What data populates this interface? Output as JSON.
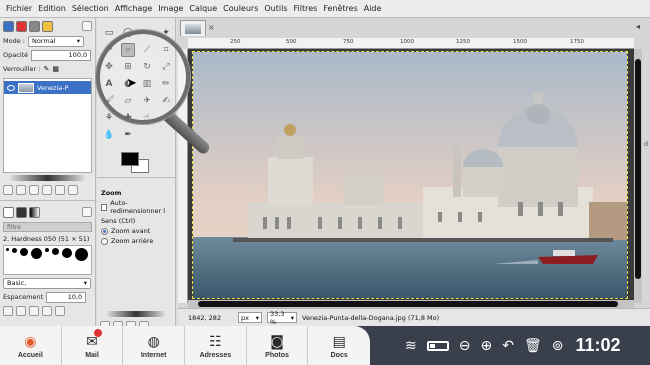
{
  "menubar": {
    "items": [
      "Fichier",
      "Edition",
      "Sélection",
      "Affichage",
      "Image",
      "Calque",
      "Couleurs",
      "Outils",
      "Filtres",
      "Fenêtres",
      "Aide"
    ]
  },
  "layers": {
    "mode_label": "Mode :",
    "mode_value": "Normal",
    "opacity_label": "Opacité",
    "opacity_value": "100,0",
    "lock_label": "Verrouiller :",
    "layer_name": "Venezia-P"
  },
  "brushes": {
    "filter_placeholder": "filtre",
    "brush_name": "2. Hardness 050 (51 × 51)",
    "preset": "Basic,",
    "spacing_label": "Espacement",
    "spacing_value": "10,0"
  },
  "toolbox": {
    "zoom_title": "Zoom",
    "auto_resize": "Auto-redimensionner l",
    "direction_label": "Sens (Ctrl)",
    "zoom_in": "Zoom avant",
    "zoom_out": "Zoom arrière"
  },
  "image": {
    "ruler_ticks": [
      "250",
      "500",
      "750",
      "1000",
      "1250",
      "1500",
      "1750"
    ],
    "coords": "1842, 282",
    "unit": "px",
    "zoom": "33,3 %",
    "file_info": "Venezia-Punta-della-Dogana.jpg (71,8 Mo)",
    "side_label": "d"
  },
  "taskbar": {
    "apps": [
      {
        "label": "Accueil",
        "icon": "home-icon"
      },
      {
        "label": "Mail",
        "icon": "mail-icon"
      },
      {
        "label": "Internet",
        "icon": "globe-icon"
      },
      {
        "label": "Adresses",
        "icon": "contacts-icon"
      },
      {
        "label": "Photos",
        "icon": "camera-icon"
      },
      {
        "label": "Docs",
        "icon": "documents-icon"
      }
    ],
    "clock": "11:02",
    "battery_level": 0.3
  }
}
